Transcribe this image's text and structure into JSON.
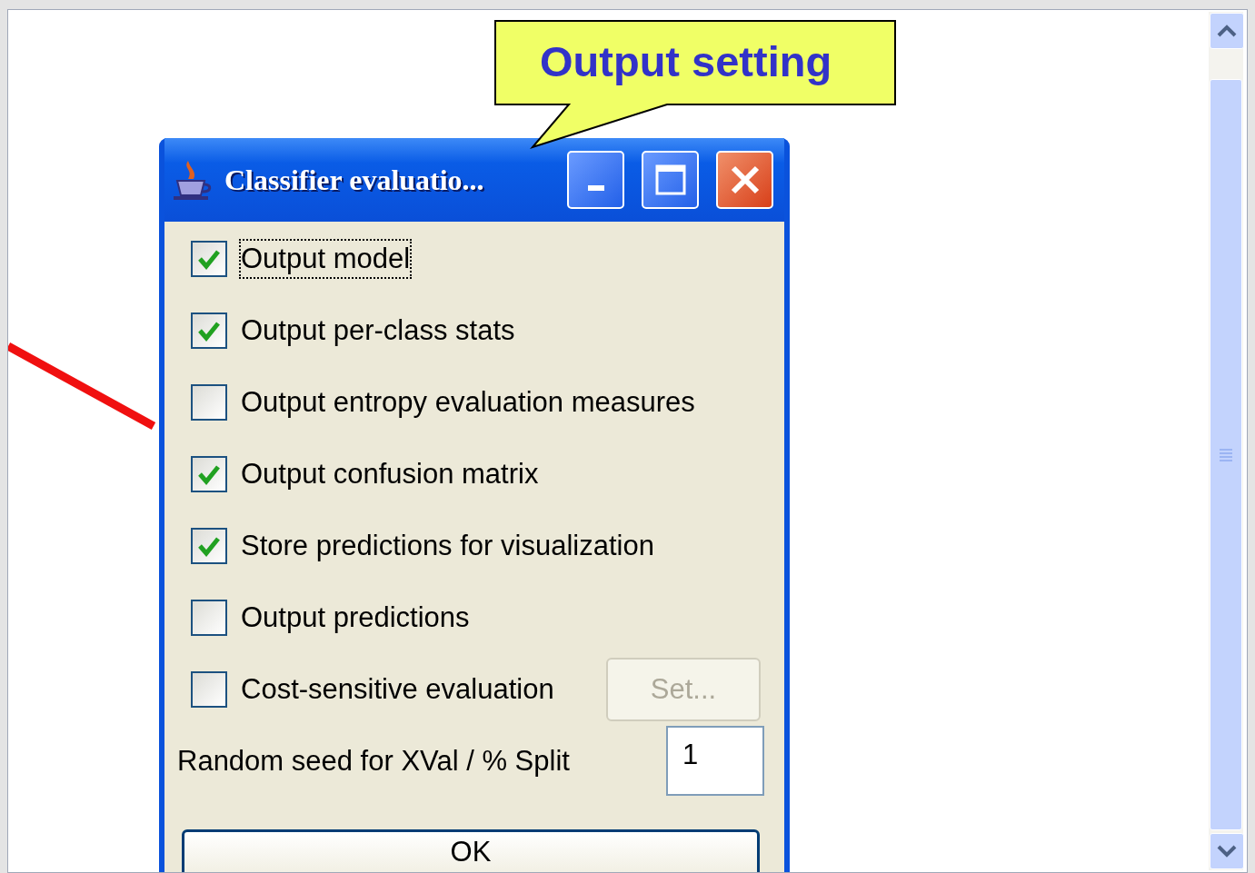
{
  "callout": {
    "text": "Output setting"
  },
  "dialog": {
    "title": "Classifier evaluatio...",
    "options": [
      {
        "label": "Output model",
        "checked": true,
        "focused": true
      },
      {
        "label": "Output per-class stats",
        "checked": true,
        "focused": false
      },
      {
        "label": "Output entropy evaluation measures",
        "checked": false,
        "focused": false
      },
      {
        "label": "Output confusion matrix",
        "checked": true,
        "focused": false
      },
      {
        "label": "Store predictions for visualization",
        "checked": true,
        "focused": false
      },
      {
        "label": "Output predictions",
        "checked": false,
        "focused": false
      },
      {
        "label": "Cost-sensitive evaluation",
        "checked": false,
        "focused": false,
        "button": {
          "label": "Set...",
          "disabled": true
        }
      }
    ],
    "seed": {
      "label": "Random seed for XVal / % Split",
      "value": "1"
    },
    "ok_button": {
      "label": "OK"
    }
  }
}
